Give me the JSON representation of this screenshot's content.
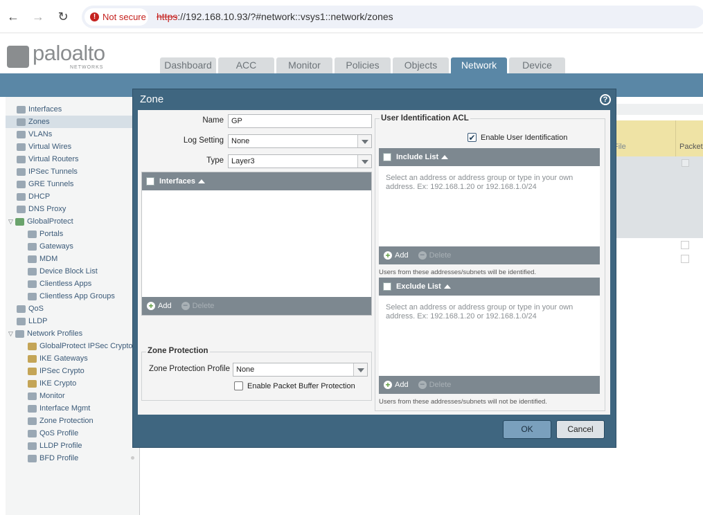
{
  "browser": {
    "not_secure": "Not secure",
    "url_proto": "https",
    "url_rest": "://192.168.10.93/?#network::vsys1::network/zones"
  },
  "brand": {
    "name": "paloalto",
    "sub": "NETWORKS"
  },
  "tabs": [
    "Dashboard",
    "ACC",
    "Monitor",
    "Policies",
    "Objects",
    "Network",
    "Device"
  ],
  "active_tab": "Network",
  "nav": [
    {
      "label": "Interfaces",
      "indent": 0
    },
    {
      "label": "Zones",
      "indent": 0,
      "selected": true
    },
    {
      "label": "VLANs",
      "indent": 0
    },
    {
      "label": "Virtual Wires",
      "indent": 0
    },
    {
      "label": "Virtual Routers",
      "indent": 0
    },
    {
      "label": "IPSec Tunnels",
      "indent": 0
    },
    {
      "label": "GRE Tunnels",
      "indent": 0
    },
    {
      "label": "DHCP",
      "indent": 0
    },
    {
      "label": "DNS Proxy",
      "indent": 0
    },
    {
      "label": "GlobalProtect",
      "indent": 0,
      "expanded": true
    },
    {
      "label": "Portals",
      "indent": 1
    },
    {
      "label": "Gateways",
      "indent": 1
    },
    {
      "label": "MDM",
      "indent": 1
    },
    {
      "label": "Device Block List",
      "indent": 1
    },
    {
      "label": "Clientless Apps",
      "indent": 1
    },
    {
      "label": "Clientless App Groups",
      "indent": 1
    },
    {
      "label": "QoS",
      "indent": 0
    },
    {
      "label": "LLDP",
      "indent": 0
    },
    {
      "label": "Network Profiles",
      "indent": 0,
      "expanded": true
    },
    {
      "label": "GlobalProtect IPSec Crypto",
      "indent": 1
    },
    {
      "label": "IKE Gateways",
      "indent": 1
    },
    {
      "label": "IPSec Crypto",
      "indent": 1
    },
    {
      "label": "IKE Crypto",
      "indent": 1
    },
    {
      "label": "Monitor",
      "indent": 1
    },
    {
      "label": "Interface Mgmt",
      "indent": 1
    },
    {
      "label": "Zone Protection",
      "indent": 1
    },
    {
      "label": "QoS Profile",
      "indent": 1
    },
    {
      "label": "LLDP Profile",
      "indent": 1
    },
    {
      "label": "BFD Profile",
      "indent": 1
    }
  ],
  "bg_table": {
    "col_file": "File",
    "col_packet": "Packet"
  },
  "dialog": {
    "title": "Zone",
    "name_label": "Name",
    "name_value": "GP",
    "log_label": "Log Setting",
    "log_value": "None",
    "type_label": "Type",
    "type_value": "Layer3",
    "interfaces_header": "Interfaces",
    "add": "Add",
    "delete": "Delete",
    "zone_protection_legend": "Zone Protection",
    "zpp_label": "Zone Protection Profile",
    "zpp_value": "None",
    "packet_buffer_label": "Enable Packet Buffer Protection",
    "uid_legend": "User Identification ACL",
    "enable_uid_label": "Enable User Identification",
    "include_header": "Include List",
    "include_placeholder": "Select an address or address group or type in your own address. Ex: 192.168.1.20 or 192.168.1.0/24",
    "include_note": "Users from these addresses/subnets will be identified.",
    "exclude_header": "Exclude List",
    "exclude_placeholder": "Select an address or address group or type in your own address. Ex: 192.168.1.20 or 192.168.1.0/24",
    "exclude_note": "Users from these addresses/subnets will not be identified.",
    "ok": "OK",
    "cancel": "Cancel"
  },
  "colors": {
    "accent": "#5a87a6",
    "dialog": "#3f6680",
    "header_bg": "#efe3a5"
  }
}
